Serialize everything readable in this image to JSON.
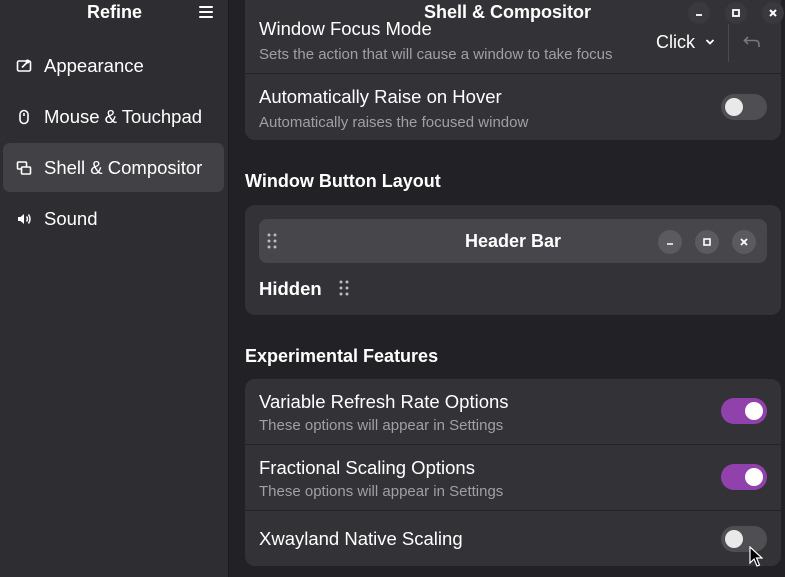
{
  "sidebar": {
    "title": "Refine",
    "menu_icon": "hamburger-menu-icon",
    "items": [
      {
        "label": "Appearance",
        "icon": "appearance-icon",
        "active": false
      },
      {
        "label": "Mouse & Touchpad",
        "icon": "mouse-icon",
        "active": false
      },
      {
        "label": "Shell & Compositor",
        "icon": "windows-icon",
        "active": true
      },
      {
        "label": "Sound",
        "icon": "speaker-icon",
        "active": false
      }
    ]
  },
  "main": {
    "title": "Shell & Compositor",
    "window_controls": [
      "minimize-icon",
      "maximize-icon",
      "close-icon"
    ],
    "focus_mode": {
      "title": "Window Focus Mode",
      "subtitle": "Sets the action that will cause a window to take focus",
      "value": "Click"
    },
    "raise_on_hover": {
      "title": "Automatically Raise on Hover",
      "subtitle": "Automatically raises the focused window",
      "enabled": false
    },
    "button_layout": {
      "section_title": "Window Button Layout",
      "header_bar_label": "Header Bar",
      "hidden_label": "Hidden"
    },
    "experimental": {
      "section_title": "Experimental Features",
      "rows": [
        {
          "title": "Variable Refresh Rate Options",
          "subtitle": "These options will appear in Settings",
          "enabled": true
        },
        {
          "title": "Fractional Scaling Options",
          "subtitle": "These options will appear in Settings",
          "enabled": true
        },
        {
          "title": "Xwayland Native Scaling",
          "subtitle": "",
          "enabled": false
        }
      ]
    }
  },
  "colors": {
    "accent": "#9141ac",
    "sidebar_bg": "#2e2e32",
    "content_bg": "#222226",
    "card_bg": "#333337"
  }
}
